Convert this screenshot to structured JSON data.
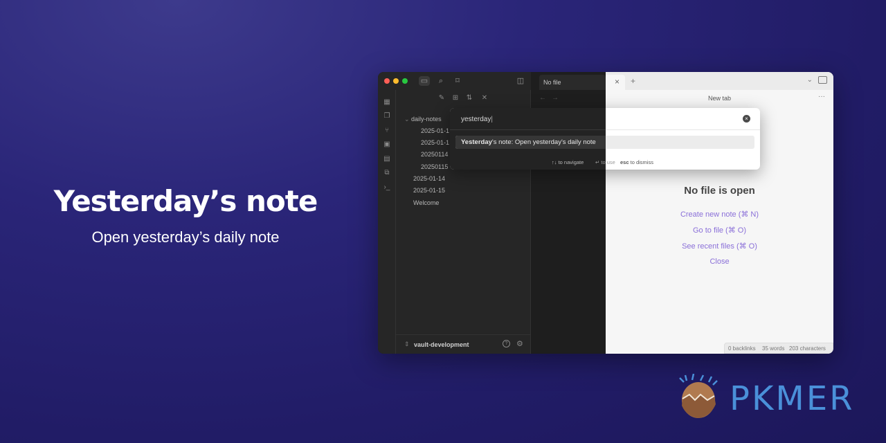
{
  "hero": {
    "title": "Yesterday’s note",
    "subtitle": "Open yesterday’s daily note"
  },
  "sidebar": {
    "tree": {
      "folder": "daily-notes",
      "children": [
        "2025-01-1",
        "2025-01-1",
        "20250114",
        "20250115"
      ],
      "root_files": [
        "2025-01-14",
        "2025-01-15",
        "Welcome"
      ]
    },
    "vault_name": "vault-development"
  },
  "tabs": {
    "dark_tab": "No file",
    "light_title": "New tab",
    "close": "×",
    "new_tab": "+"
  },
  "empty_state": {
    "heading": "No file is open",
    "create": "Create new note (⌘ N)",
    "goto": "Go to file (⌘ O)",
    "recent": "See recent files (⌘ O)",
    "close": "Close"
  },
  "palette": {
    "query": "yesterday",
    "suggestion_bold": "Yesterday",
    "suggestion_rest": "'s note: Open yesterday's daily note",
    "hint_navigate_key": "↑↓",
    "hint_navigate": "to navigate",
    "hint_use_key": "↵",
    "hint_use": "to use",
    "hint_dismiss_key": "esc",
    "hint_dismiss": "to dismiss"
  },
  "status": {
    "backlinks": "0 backlinks",
    "words": "35 words",
    "chars": "203 characters"
  },
  "logo": {
    "text": "PKMER"
  },
  "colors": {
    "accent": "#8a6fd8",
    "bg": "#211c66",
    "logo": "#4a90d9"
  }
}
